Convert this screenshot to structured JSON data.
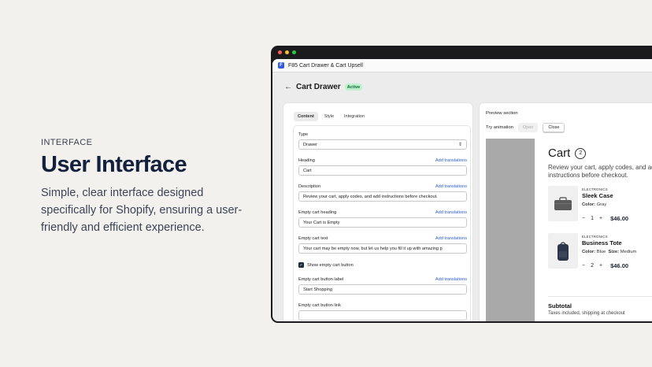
{
  "marketing": {
    "eyebrow": "INTERFACE",
    "headline": "User Interface",
    "subtext": "Simple, clear interface designed specifically for Shopify, ensuring a user-friendly and efficient experience."
  },
  "window": {
    "dot_colors": [
      "#ff5f57",
      "#febc2e",
      "#28c840"
    ],
    "app_name": "F85 Cart Drawer & Cart Upsell",
    "page_title": "Cart Drawer",
    "status_badge": "Active"
  },
  "tabs": [
    "Content",
    "Style",
    "Integration"
  ],
  "form": {
    "type": {
      "label": "Type",
      "value": "Drawer"
    },
    "heading": {
      "label": "Heading",
      "link": "Add translations",
      "value": "Cart"
    },
    "description": {
      "label": "Description",
      "link": "Add translations",
      "value": "Review your cart, apply codes, and add instructions before checkout."
    },
    "empty_heading": {
      "label": "Empty cart heading",
      "link": "Add translations",
      "value": "Your Cart is Empty"
    },
    "empty_text": {
      "label": "Empty cart text",
      "link": "Add translations",
      "value": "Your cart may be empty now, but let us help you fill it up with amazing p"
    },
    "show_empty_button": {
      "label": "Show empty cart button",
      "checked": true
    },
    "empty_button_label": {
      "label": "Empty cart button label",
      "link": "Add translations",
      "value": "Start Shopping"
    },
    "empty_button_link": {
      "label": "Empty cart button link"
    }
  },
  "preview": {
    "section_title": "Preview section",
    "try_animation": "Try animation",
    "open_label": "Open",
    "close_label": "Close",
    "cart_title": "Cart",
    "cart_count": "2",
    "cart_description": "Review your cart, apply codes, and add instructions before checkout.",
    "items": [
      {
        "category": "ELECTRONICS",
        "name": "Sleek Case",
        "color_label": "Color:",
        "color": "Gray",
        "size_label": "",
        "size": "",
        "quantity": "1",
        "price": "$46.00"
      },
      {
        "category": "ELECTRONICS",
        "name": "Business Tote",
        "color_label": "Color:",
        "color": "Blue",
        "size_label": "Size:",
        "size": "Medium",
        "quantity": "2",
        "price": "$46.00"
      }
    ],
    "subtotal_label": "Subtotal",
    "subtotal_note": "Taxes included, shipping at checkout"
  }
}
